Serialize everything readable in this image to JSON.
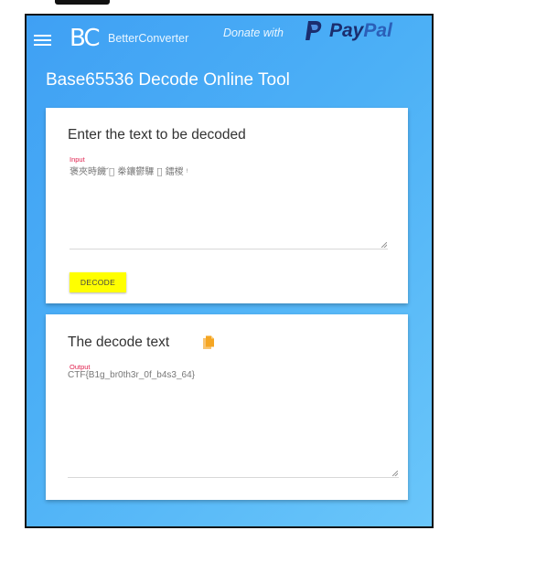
{
  "header": {
    "logo_mark": "BC",
    "logo_text": "BetterConverter",
    "donate_text": "Donate with",
    "paypal_pay": "Pay",
    "paypal_pal": "Pal",
    "menu_icon": "hamburger-menu-icon"
  },
  "page": {
    "title": "Base65536 Decode Online Tool"
  },
  "input_card": {
    "title": "Enter the text to be decoded",
    "field_label": "Input",
    "field_value": "褒夾時饑 ᷄⃞ 桊鑲鬱驆 ⎵ 鐳椶 ᵎ",
    "button_label": "DECODE"
  },
  "output_card": {
    "title": "The decode text",
    "copy_icon": "copy-icon",
    "field_label": "Output",
    "field_value": "CTF{B1g_br0th3r_0f_b4s3_64}"
  },
  "colors": {
    "accent": "#ffff00",
    "label": "#e0224f",
    "copy_icon": "#f5a623",
    "background_start": "#3fa0f4",
    "background_end": "#6ac6fa"
  }
}
